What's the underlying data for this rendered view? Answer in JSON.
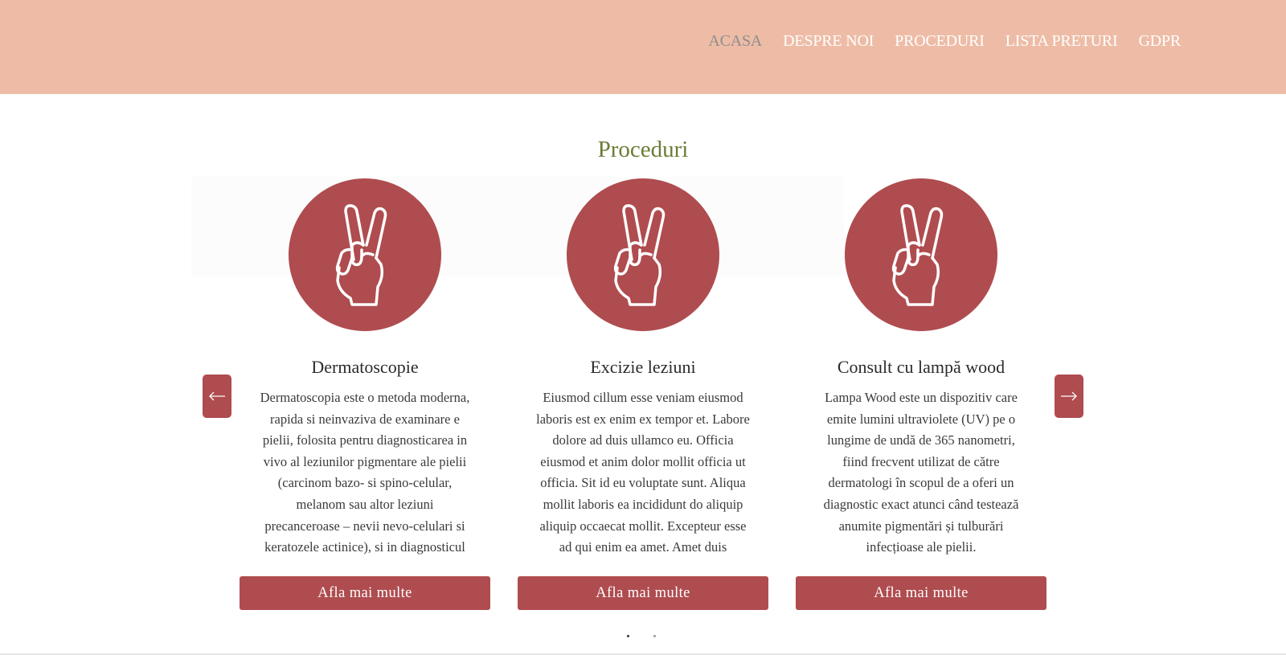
{
  "nav": {
    "items": [
      {
        "label": "ACASA",
        "active": true
      },
      {
        "label": "DESPRE NOI",
        "active": false
      },
      {
        "label": "PROCEDURI",
        "active": false
      },
      {
        "label": "LISTA PRETURI",
        "active": false
      },
      {
        "label": "GDPR",
        "active": false
      }
    ]
  },
  "section": {
    "title": "Proceduri"
  },
  "cards": [
    {
      "icon": "peace-hand-icon",
      "title": "Dermatoscopie",
      "description": "Dermatoscopia este o metoda moderna, rapida si neinvaziva de examinare e pielii, folosita pentru diagnosticarea in vivo al leziunilor pigmentare ale pielii (carcinom bazo- si spino-celular, melanom sau altor leziuni precanceroase – nevii nevo-celulari si keratozele actinice), si in diagnosticul",
      "button": "Afla mai multe"
    },
    {
      "icon": "peace-hand-icon",
      "title": "Excizie leziuni",
      "description": "Eiusmod cillum esse veniam eiusmod laboris est ex enim ex tempor et. Labore dolore ad duis ullamco eu. Officia eiusmod et anim dolor mollit officia ut officia. Sit id eu voluptate sunt. Aliqua mollit laboris ea incididunt do aliquip aliquip occaecat mollit. Excepteur esse ad qui enim ea amet. Amet duis",
      "button": "Afla mai multe"
    },
    {
      "icon": "peace-hand-icon",
      "title": "Consult cu lampă wood",
      "description": "Lampa Wood este un dispozitiv care emite lumini ultraviolete (UV) pe o lungime de undă de 365 nanometri, fiind frecvent utilizat de către dermatologi în scopul de a oferi un diagnostic exact atunci când testează anumite pigmentări și tulburări infecțioase ale pielii.",
      "button": "Afla mai multe"
    }
  ],
  "carousel": {
    "prev_icon": "arrow-left-icon",
    "next_icon": "arrow-right-icon",
    "current_page": 1,
    "total_pages": 2
  },
  "colors": {
    "navbar": "#eebca6",
    "accent": "#af4c4f",
    "title": "#6a7d35",
    "nav_active": "#8d8d8d"
  }
}
